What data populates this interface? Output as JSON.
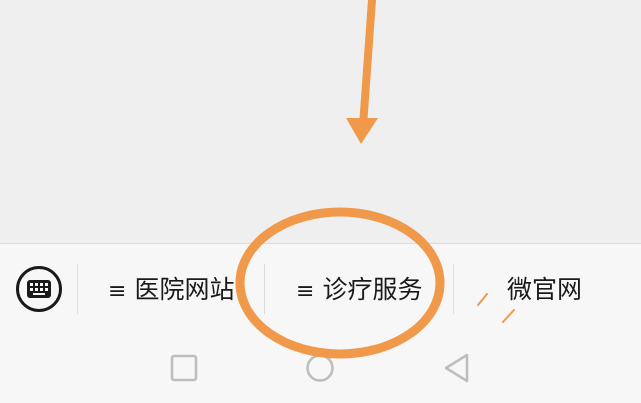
{
  "menu": {
    "items": [
      {
        "icon": "≡",
        "label": "医院网站"
      },
      {
        "icon": "≡",
        "label": "诊疗服务"
      },
      {
        "label": "微官网"
      }
    ]
  },
  "nav": {
    "buttons": [
      "recents-square-icon",
      "home-circle-icon",
      "back-triangle-icon"
    ]
  },
  "annotation": {
    "color": "#f0994a"
  }
}
